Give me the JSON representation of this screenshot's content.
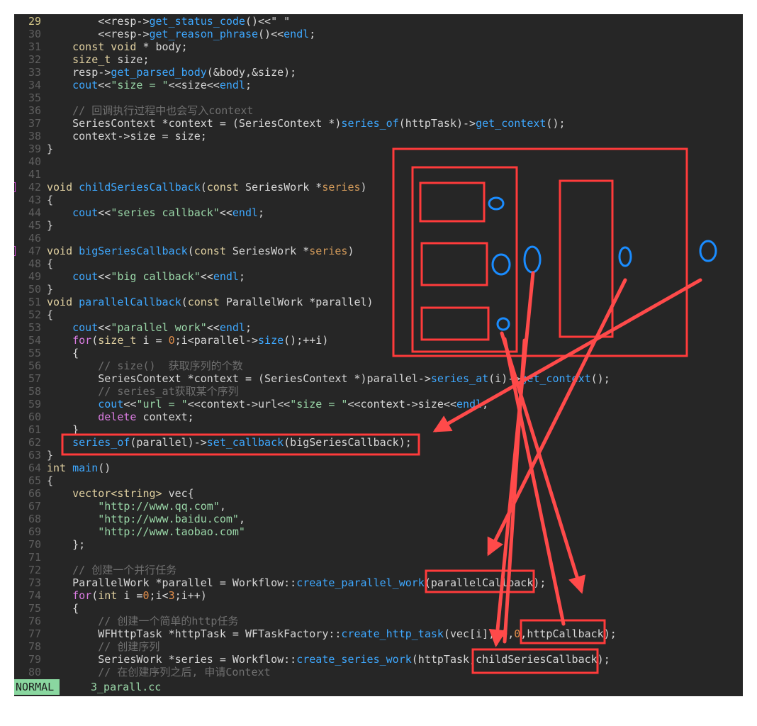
{
  "editor": {
    "lines": [
      {
        "n": "29",
        "tokens": [
          [
            "plain",
            "        <<resp->"
          ],
          [
            "fn",
            "get_status_code"
          ],
          [
            "plain",
            "()<<\" \""
          ]
        ]
      },
      {
        "n": "30",
        "tokens": [
          [
            "plain",
            "        <<resp->"
          ],
          [
            "fn",
            "get_reason_phrase"
          ],
          [
            "plain",
            "()<<"
          ],
          [
            "fn",
            "endl"
          ],
          [
            "plain",
            ";"
          ]
        ]
      },
      {
        "n": "31",
        "tokens": [
          [
            "plain",
            "    "
          ],
          [
            "kw",
            "const void"
          ],
          [
            "plain",
            " * body;"
          ]
        ]
      },
      {
        "n": "32",
        "tokens": [
          [
            "plain",
            "    "
          ],
          [
            "kw",
            "size_t"
          ],
          [
            "plain",
            " size;"
          ]
        ]
      },
      {
        "n": "33",
        "tokens": [
          [
            "plain",
            "    resp->"
          ],
          [
            "fn",
            "get_parsed_body"
          ],
          [
            "plain",
            "(&body,&size);"
          ]
        ]
      },
      {
        "n": "34",
        "tokens": [
          [
            "plain",
            "    "
          ],
          [
            "fn",
            "cout"
          ],
          [
            "plain",
            "<<"
          ],
          [
            "str",
            "\"size = \""
          ],
          [
            "plain",
            "<<size<<"
          ],
          [
            "fn",
            "endl"
          ],
          [
            "plain",
            ";"
          ]
        ]
      },
      {
        "n": "35",
        "tokens": []
      },
      {
        "n": "36",
        "tokens": [
          [
            "com",
            "    // 回调执行过程中也会写入context"
          ]
        ]
      },
      {
        "n": "37",
        "tokens": [
          [
            "plain",
            "    SeriesContext *context = (SeriesContext *)"
          ],
          [
            "fn",
            "series_of"
          ],
          [
            "plain",
            "(httpTask)->"
          ],
          [
            "fn",
            "get_context"
          ],
          [
            "plain",
            "();"
          ]
        ]
      },
      {
        "n": "38",
        "tokens": [
          [
            "plain",
            "    context->size = size;"
          ]
        ]
      },
      {
        "n": "39",
        "tokens": [
          [
            "plain",
            "}"
          ]
        ]
      },
      {
        "n": "40",
        "tokens": []
      },
      {
        "n": "41",
        "tokens": []
      },
      {
        "n": "42",
        "sign": true,
        "tokens": [
          [
            "kw",
            "void"
          ],
          [
            "plain",
            " "
          ],
          [
            "fn",
            "childSeriesCallback"
          ],
          [
            "plain",
            "("
          ],
          [
            "kw",
            "const"
          ],
          [
            "plain",
            " SeriesWork *"
          ],
          [
            "param",
            "series"
          ],
          [
            "plain",
            ")"
          ]
        ]
      },
      {
        "n": "43",
        "tokens": [
          [
            "plain",
            "{"
          ]
        ]
      },
      {
        "n": "44",
        "tokens": [
          [
            "plain",
            "    "
          ],
          [
            "fn",
            "cout"
          ],
          [
            "plain",
            "<<"
          ],
          [
            "str",
            "\"series callback\""
          ],
          [
            "plain",
            "<<"
          ],
          [
            "fn",
            "endl"
          ],
          [
            "plain",
            ";"
          ]
        ]
      },
      {
        "n": "45",
        "tokens": [
          [
            "plain",
            "}"
          ]
        ]
      },
      {
        "n": "46",
        "tokens": []
      },
      {
        "n": "47",
        "sign": true,
        "tokens": [
          [
            "kw",
            "void"
          ],
          [
            "plain",
            " "
          ],
          [
            "fn",
            "bigSeriesCallback"
          ],
          [
            "plain",
            "("
          ],
          [
            "kw",
            "const"
          ],
          [
            "plain",
            " SeriesWork *"
          ],
          [
            "param",
            "series"
          ],
          [
            "plain",
            ")"
          ]
        ]
      },
      {
        "n": "48",
        "tokens": [
          [
            "plain",
            "{"
          ]
        ]
      },
      {
        "n": "49",
        "tokens": [
          [
            "plain",
            "    "
          ],
          [
            "fn",
            "cout"
          ],
          [
            "plain",
            "<<"
          ],
          [
            "str",
            "\"big callback\""
          ],
          [
            "plain",
            "<<"
          ],
          [
            "fn",
            "endl"
          ],
          [
            "plain",
            ";"
          ]
        ]
      },
      {
        "n": "50",
        "tokens": [
          [
            "plain",
            "}"
          ]
        ]
      },
      {
        "n": "51",
        "tokens": [
          [
            "kw",
            "void"
          ],
          [
            "plain",
            " "
          ],
          [
            "fn",
            "parallelCallback"
          ],
          [
            "plain",
            "("
          ],
          [
            "kw",
            "const"
          ],
          [
            "plain",
            " ParallelWork *parallel)"
          ]
        ]
      },
      {
        "n": "52",
        "tokens": [
          [
            "plain",
            "{"
          ]
        ]
      },
      {
        "n": "53",
        "tokens": [
          [
            "plain",
            "    "
          ],
          [
            "fn",
            "cout"
          ],
          [
            "plain",
            "<<"
          ],
          [
            "str",
            "\"parallel work\""
          ],
          [
            "plain",
            "<<"
          ],
          [
            "fn",
            "endl"
          ],
          [
            "plain",
            ";"
          ]
        ]
      },
      {
        "n": "54",
        "tokens": [
          [
            "plain",
            "    "
          ],
          [
            "ctl",
            "for"
          ],
          [
            "plain",
            "("
          ],
          [
            "kw",
            "size_t"
          ],
          [
            "plain",
            " i = "
          ],
          [
            "num",
            "0"
          ],
          [
            "plain",
            ";i<parallel->"
          ],
          [
            "fn",
            "size"
          ],
          [
            "plain",
            "();++i)"
          ]
        ]
      },
      {
        "n": "55",
        "tokens": [
          [
            "plain",
            "    {"
          ]
        ]
      },
      {
        "n": "56",
        "tokens": [
          [
            "com",
            "        // size()  获取序列的个数"
          ]
        ]
      },
      {
        "n": "57",
        "tokens": [
          [
            "plain",
            "        SeriesContext *context = (SeriesContext *)parallel->"
          ],
          [
            "fn",
            "series_at"
          ],
          [
            "plain",
            "(i)->"
          ],
          [
            "fn",
            "get_context"
          ],
          [
            "plain",
            "();"
          ]
        ]
      },
      {
        "n": "58",
        "tokens": [
          [
            "com",
            "        // series_at获取某个序列"
          ]
        ]
      },
      {
        "n": "59",
        "tokens": [
          [
            "plain",
            "        "
          ],
          [
            "fn",
            "cout"
          ],
          [
            "plain",
            "<<"
          ],
          [
            "str",
            "\"url = \""
          ],
          [
            "plain",
            "<<context->url<<"
          ],
          [
            "str",
            "\"size = \""
          ],
          [
            "plain",
            "<<context->size<<"
          ],
          [
            "fn",
            "endl"
          ],
          [
            "plain",
            ";"
          ]
        ]
      },
      {
        "n": "60",
        "tokens": [
          [
            "plain",
            "        "
          ],
          [
            "ctl",
            "delete"
          ],
          [
            "plain",
            " context;"
          ]
        ]
      },
      {
        "n": "61",
        "tokens": [
          [
            "plain",
            "    }"
          ]
        ]
      },
      {
        "n": "62",
        "tokens": [
          [
            "plain",
            "    "
          ],
          [
            "fn",
            "series_of"
          ],
          [
            "plain",
            "(parallel)->"
          ],
          [
            "fn",
            "set_callback"
          ],
          [
            "plain",
            "(bigSeriesCallback);"
          ]
        ]
      },
      {
        "n": "63",
        "tokens": [
          [
            "plain",
            "}"
          ]
        ]
      },
      {
        "n": "64",
        "tokens": [
          [
            "kw",
            "int"
          ],
          [
            "plain",
            " "
          ],
          [
            "fn",
            "main"
          ],
          [
            "plain",
            "()"
          ]
        ]
      },
      {
        "n": "65",
        "tokens": [
          [
            "plain",
            "{"
          ]
        ]
      },
      {
        "n": "66",
        "tokens": [
          [
            "plain",
            "    "
          ],
          [
            "kw",
            "vector<string>"
          ],
          [
            "plain",
            " vec{"
          ]
        ]
      },
      {
        "n": "67",
        "tokens": [
          [
            "plain",
            "        "
          ],
          [
            "str",
            "\"http://www.qq.com\""
          ],
          [
            "plain",
            ","
          ]
        ]
      },
      {
        "n": "68",
        "tokens": [
          [
            "plain",
            "        "
          ],
          [
            "str",
            "\"http://www.baidu.com\""
          ],
          [
            "plain",
            ","
          ]
        ]
      },
      {
        "n": "69",
        "tokens": [
          [
            "plain",
            "        "
          ],
          [
            "str",
            "\"http://www.taobao.com\""
          ]
        ]
      },
      {
        "n": "70",
        "tokens": [
          [
            "plain",
            "    };"
          ]
        ]
      },
      {
        "n": "71",
        "tokens": []
      },
      {
        "n": "72",
        "tokens": [
          [
            "com",
            "    // 创建一个并行任务"
          ]
        ]
      },
      {
        "n": "73",
        "tokens": [
          [
            "plain",
            "    ParallelWork *parallel = Workflow::"
          ],
          [
            "fn",
            "create_parallel_work"
          ],
          [
            "plain",
            "(parallelCallback);"
          ]
        ]
      },
      {
        "n": "74",
        "tokens": [
          [
            "plain",
            "    "
          ],
          [
            "ctl",
            "for"
          ],
          [
            "plain",
            "("
          ],
          [
            "kw",
            "int"
          ],
          [
            "plain",
            " i ="
          ],
          [
            "num",
            "0"
          ],
          [
            "plain",
            ";i<"
          ],
          [
            "num",
            "3"
          ],
          [
            "plain",
            ";i++)"
          ]
        ]
      },
      {
        "n": "75",
        "tokens": [
          [
            "plain",
            "    {"
          ]
        ]
      },
      {
        "n": "76",
        "tokens": [
          [
            "com",
            "        // 创建一个简单的http任务"
          ]
        ]
      },
      {
        "n": "77",
        "tokens": [
          [
            "plain",
            "        WFHttpTask *httpTask = WFTaskFactory::"
          ],
          [
            "fn",
            "create_http_task"
          ],
          [
            "plain",
            "(vec[i],"
          ],
          [
            "num",
            "10"
          ],
          [
            "plain",
            ","
          ],
          [
            "num",
            "0"
          ],
          [
            "plain",
            ",httpCallback);"
          ]
        ]
      },
      {
        "n": "78",
        "tokens": [
          [
            "com",
            "        // 创建序列"
          ]
        ]
      },
      {
        "n": "79",
        "tokens": [
          [
            "plain",
            "        SeriesWork *series = Workflow::"
          ],
          [
            "fn",
            "create_series_work"
          ],
          [
            "plain",
            "(httpTask,childSeriesCallback);"
          ]
        ]
      },
      {
        "n": "80",
        "tokens": [
          [
            "com",
            "        // 在创建序列之后, 申请Context"
          ]
        ]
      }
    ]
  },
  "statusbar": {
    "mode": "NORMAL",
    "filename": "3_parall.cc"
  },
  "annotation_colors": {
    "box": "#ff3b3b",
    "arrow": "#ff4a4a",
    "circle": "#1a8cff"
  }
}
